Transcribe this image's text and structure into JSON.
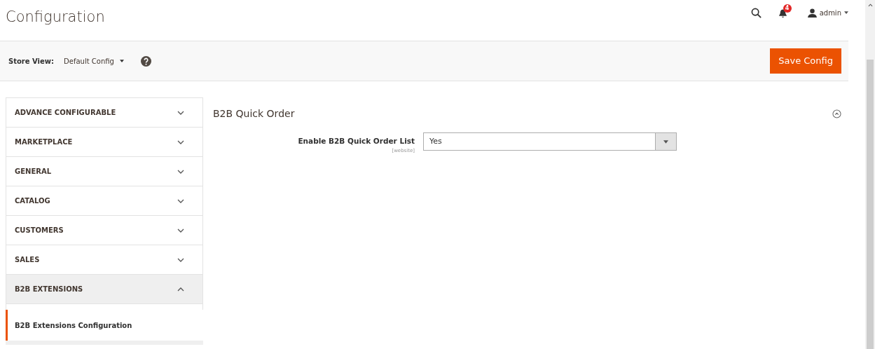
{
  "page_title": "Configuration",
  "header": {
    "notification_count": "4",
    "user": "admin"
  },
  "store_view": {
    "label": "Store View:",
    "value": "Default Config"
  },
  "save_button": "Save Config",
  "sidebar": {
    "sections": [
      {
        "label": "ADVANCE CONFIGURABLE",
        "expanded": false
      },
      {
        "label": "MARKETPLACE",
        "expanded": false
      },
      {
        "label": "GENERAL",
        "expanded": false
      },
      {
        "label": "CATALOG",
        "expanded": false
      },
      {
        "label": "CUSTOMERS",
        "expanded": false
      },
      {
        "label": "SALES",
        "expanded": false
      },
      {
        "label": "B2B EXTENSIONS",
        "expanded": true,
        "children": [
          {
            "label": "B2B Extensions Configuration",
            "selected": true
          }
        ]
      }
    ]
  },
  "group": {
    "title": "B2B Quick Order",
    "expanded": true,
    "fields": [
      {
        "label": "Enable B2B Quick Order List",
        "scope": "[website]",
        "value": "Yes"
      }
    ]
  }
}
